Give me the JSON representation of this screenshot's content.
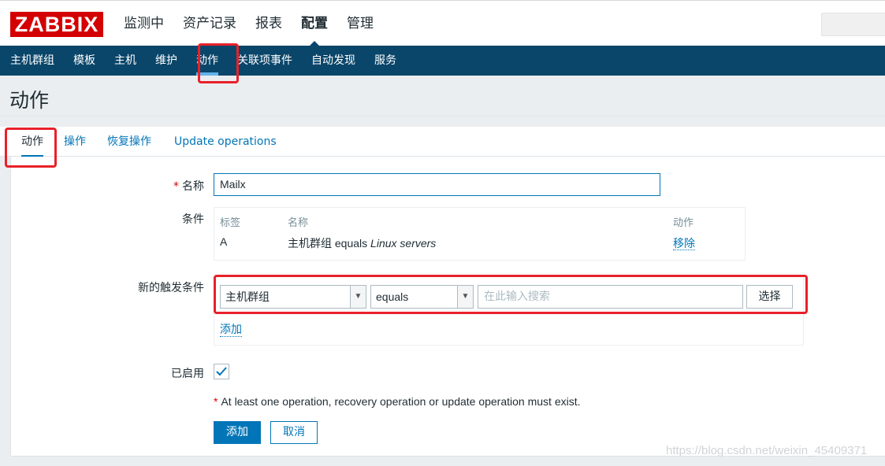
{
  "logo": {
    "text": "ZABBIX"
  },
  "top_nav": [
    "监测中",
    "资产记录",
    "报表",
    "配置",
    "管理"
  ],
  "sub_nav": [
    "主机群组",
    "模板",
    "主机",
    "维护",
    "动作",
    "关联项事件",
    "自动发现",
    "服务"
  ],
  "page": {
    "title": "动作"
  },
  "tabs": [
    "动作",
    "操作",
    "恢复操作",
    "Update operations"
  ],
  "form": {
    "name_label": "名称",
    "name_value": "Mailx",
    "conditions_label": "条件",
    "conditions_headers": {
      "label": "标签",
      "name": "名称",
      "action": "动作"
    },
    "condition_row": {
      "label": "A",
      "name_prefix": "主机群组 equals ",
      "name_value": "Linux servers",
      "action": "移除"
    },
    "new_condition_label": "新的触发条件",
    "condition_type": "主机群组",
    "operator": "equals",
    "search_placeholder": "在此输入搜索",
    "select_button": "选择",
    "add_condition_link": "添加",
    "enabled_label": "已启用",
    "enabled": true,
    "warning_text": "At least one operation, recovery operation or update operation must exist.",
    "submit_button": "添加",
    "cancel_button": "取消"
  },
  "watermark": "https://blog.csdn.net/weixin_45409371",
  "colors": {
    "brand": "#d40000",
    "nav": "#0a466a",
    "link": "#0275b8",
    "annotation": "#e8212a"
  }
}
